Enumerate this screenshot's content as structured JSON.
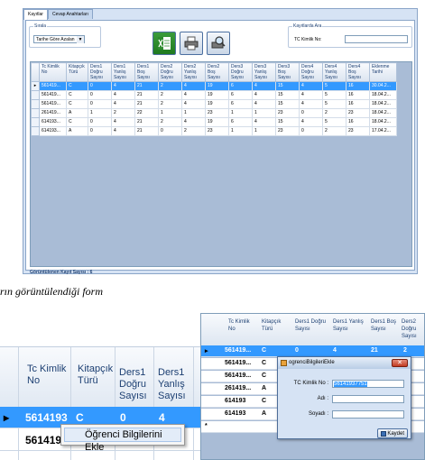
{
  "main_window": {
    "tabs": [
      "Kayıtlar",
      "Cevap Anahtarları"
    ],
    "sort_group_label": "Sırala",
    "sort_value": "Tarihe Göre Azalan",
    "search_group_label": "Kayıtlarda Ara",
    "tc_label": "TC Kimlik No:",
    "footer_text": "Görüntülenen Kayıt Sayısı : 6",
    "columns": [
      "Tc Kimlik No",
      "Kitapçık Türü",
      "Ders1 Doğru Sayısı",
      "Ders1 Yanlış Sayısı",
      "Ders1 Boş Sayısı",
      "Ders2 Doğru Sayısı",
      "Ders2 Yanlış Sayısı",
      "Ders2 Boş Sayısı",
      "Ders3 Doğru Sayısı",
      "Ders3 Yanlış Sayısı",
      "Ders3 Boş Sayısı",
      "Ders4 Doğru Sayısı",
      "Ders4 Yanlış Sayısı",
      "Ders4 Boş Sayısı",
      "Eklenme Tarihi"
    ],
    "rows": [
      [
        "561419...",
        "C",
        "0",
        "4",
        "21",
        "2",
        "4",
        "19",
        "6",
        "4",
        "15",
        "4",
        "5",
        "16",
        "30.04.2..."
      ],
      [
        "561419...",
        "C",
        "0",
        "4",
        "21",
        "2",
        "4",
        "19",
        "6",
        "4",
        "15",
        "4",
        "5",
        "16",
        "18.04.2..."
      ],
      [
        "561419...",
        "C",
        "0",
        "4",
        "21",
        "2",
        "4",
        "19",
        "6",
        "4",
        "15",
        "4",
        "5",
        "16",
        "18.04.2..."
      ],
      [
        "261419...",
        "A",
        "1",
        "2",
        "22",
        "1",
        "1",
        "23",
        "1",
        "1",
        "23",
        "0",
        "2",
        "23",
        "18.04.2..."
      ],
      [
        "614193...",
        "C",
        "0",
        "4",
        "21",
        "2",
        "4",
        "19",
        "6",
        "4",
        "15",
        "4",
        "5",
        "16",
        "18.04.2..."
      ],
      [
        "614193...",
        "A",
        "0",
        "4",
        "21",
        "0",
        "2",
        "23",
        "1",
        "1",
        "23",
        "0",
        "2",
        "23",
        "17.04.2..."
      ]
    ],
    "row_indicator": "▸"
  },
  "caption": "rın görüntülendiği form",
  "crop_left": {
    "columns": [
      "Tc Kimlik No",
      "Kitapçık Türü",
      "Ders1 Doğru Sayısı",
      "Ders1 Yanlış Sayısı"
    ],
    "row1": [
      "5614193",
      "C",
      "0",
      "4"
    ],
    "row2": [
      "5614193"
    ],
    "context_menu_item": "Öğrenci Bilgilerini Ekle"
  },
  "crop_right": {
    "columns": [
      "Tc Kimlik No",
      "Kitapçık Türü",
      "Ders1 Doğru Sayısı",
      "Ders1 Yanlış Sayısı",
      "Ders1 Boş Sayısı",
      "Ders2 Doğru Sayısı"
    ],
    "rows": [
      [
        "561419...",
        "C",
        "0",
        "4",
        "21",
        "2"
      ],
      [
        "561419...",
        "C"
      ],
      [
        "561419...",
        "C"
      ],
      [
        "261419...",
        "A"
      ],
      [
        "614193",
        "C"
      ],
      [
        "614193",
        "A"
      ]
    ],
    "new_row_marker": "*",
    "dialog": {
      "title": "ogrenciBilgileriEkle",
      "tc_label": "TC Kimlik No :",
      "tc_value": "56141937751",
      "name_label": "Adı :",
      "surname_label": "Soyadı :",
      "save_label": "Kaydet",
      "close_symbol": "✕"
    }
  },
  "icons": [
    "excel-icon",
    "print-icon",
    "print-preview-icon",
    "save-icon",
    "form-icon"
  ],
  "colors": {
    "selection": "#3399ff",
    "header_text": "#1c3f72"
  }
}
